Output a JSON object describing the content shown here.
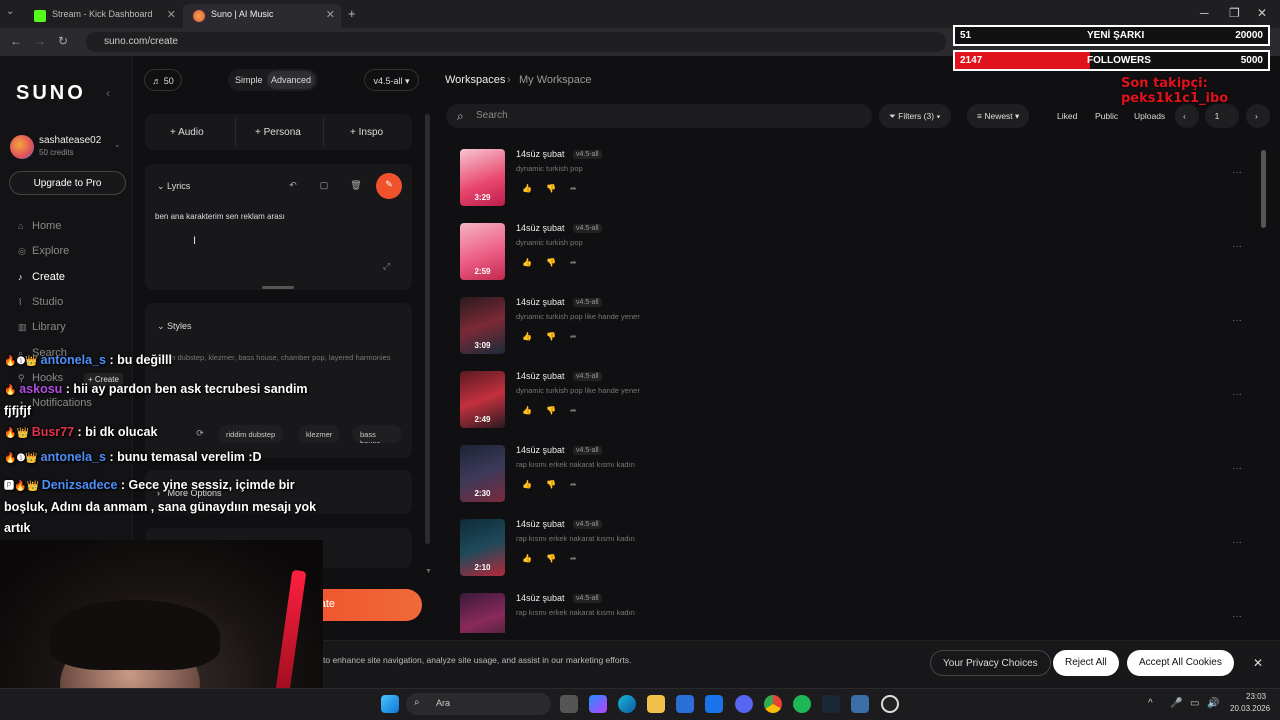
{
  "browser": {
    "tabs": [
      {
        "title": "Stream - Kick Dashboard",
        "active": false
      },
      {
        "title": "Suno | AI Music",
        "active": true
      }
    ],
    "url": "suno.com/create"
  },
  "sidebar": {
    "logo": "SUNO",
    "username": "sashatease02",
    "credits": "50 credits",
    "upgrade_label": "Upgrade to Pro",
    "items": [
      {
        "label": "Home",
        "icon": "home-icon"
      },
      {
        "label": "Explore",
        "icon": "compass-icon"
      },
      {
        "label": "Create",
        "icon": "music-note-icon"
      },
      {
        "label": "Studio",
        "icon": "studio-icon"
      },
      {
        "label": "Library",
        "icon": "library-icon"
      },
      {
        "label": "Search",
        "icon": "search-icon"
      },
      {
        "label": "Hooks",
        "icon": "hook-icon"
      },
      {
        "label": "Notifications",
        "icon": "bell-icon"
      }
    ],
    "create_tooltip": "+ Create"
  },
  "create_panel": {
    "credits_count": "50",
    "mode_simple": "Simple",
    "mode_advanced": "Advanced",
    "model": "v4.5-all",
    "add_audio": "Audio",
    "add_persona": "Persona",
    "add_inspo": "Inspo",
    "lyrics_label": "Lyrics",
    "lyrics_text": "ben ana karakterim sen reklam arası",
    "styles_label": "Styles",
    "styles_text": "riddim dubstep, klezmer, bass house, chamber pop, layered harmonies",
    "style_chips": [
      "riddim dubstep",
      "klezmer",
      "bass house"
    ],
    "more_options": "More Options",
    "create_button": "Create"
  },
  "workspace": {
    "breadcrumb_root": "Workspaces",
    "breadcrumb_current": "My Workspace",
    "search_placeholder": "Search",
    "filters_label": "Filters (3)",
    "sort_label": "Newest",
    "liked_label": "Liked",
    "public_label": "Public",
    "uploads_label": "Uploads",
    "page": "1",
    "songs": [
      {
        "title": "14süz şubat",
        "version": "v4.5-all",
        "desc": "dynamic turkish pop",
        "duration": "3:29"
      },
      {
        "title": "14süz şubat",
        "version": "v4.5-all",
        "desc": "dynamic turkish pop",
        "duration": "2:59"
      },
      {
        "title": "14süz şubat",
        "version": "v4.5-all",
        "desc": "dynamic turkish pop like hande yener",
        "duration": "3:09"
      },
      {
        "title": "14süz şubat",
        "version": "v4.5-all",
        "desc": "dynamic turkish pop like hande yener",
        "duration": "2:49"
      },
      {
        "title": "14süz şubat",
        "version": "v4.5-all",
        "desc": "rap kısmı erkek nakarat kısmı kadın",
        "duration": "2:30"
      },
      {
        "title": "14süz şubat",
        "version": "v4.5-all",
        "desc": "rap kısmı erkek nakarat kısmı kadın",
        "duration": "2:10"
      },
      {
        "title": "14süz şubat",
        "version": "v4.5-all",
        "desc": "rap kısmı erkek nakarat kısmı kadın",
        "duration": ""
      }
    ]
  },
  "stream_overlay": {
    "songs_count": "51",
    "songs_label": "YENİ ŞARKI",
    "songs_goal": "20000",
    "followers_count": "2147",
    "followers_label": "FOLLOWERS",
    "followers_goal": "5000",
    "followers_fill": 0.43,
    "last_follower": "Son takipçi: peks1k1c1_ibo",
    "chat": [
      {
        "user": "antonela_s",
        "msg": " : bu değilll",
        "color": "#4f8ef7"
      },
      {
        "user": "askosu",
        "msg": " : hii ay pardon ben ask tecrubesi sandim fjfjfjf",
        "color": "#b04de0"
      },
      {
        "user": "Busr77",
        "msg": " : bi dk olucak",
        "color": "#e0334a"
      },
      {
        "user": "antonela_s",
        "msg": " : bunu temasal verelim :D",
        "color": "#4f8ef7"
      },
      {
        "user": "Denizsadece",
        "msg": " : Gece yine sessiz, içimde bir boşluk, Adını da anmam , sana günaydıın mesajı yok artık",
        "color": "#4f8ef7"
      }
    ]
  },
  "cookie": {
    "text": "to enhance site navigation, analyze site usage, and assist in our marketing efforts.",
    "privacy": "Your Privacy Choices",
    "reject": "Reject All",
    "accept": "Accept All Cookies"
  },
  "taskbar": {
    "search_label": "Ara",
    "time": "23:03",
    "date": "20.03.2026"
  },
  "colors": {
    "accent_orange": "#f0522c",
    "followers_bar": "#e0121c",
    "last_follower_text": "#e0121c"
  }
}
